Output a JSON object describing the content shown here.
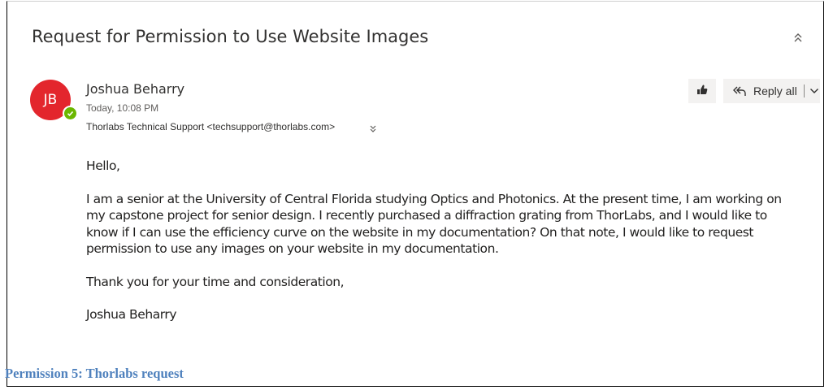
{
  "email": {
    "subject": "Request for Permission to Use Website Images",
    "avatar_initials": "JB",
    "sender_name": "Joshua Beharry",
    "sent_time": "Today, 10:08 PM",
    "recipients": "Thorlabs Technical Support <techsupport@thorlabs.com>",
    "actions": {
      "reply_all_label": "Reply all"
    },
    "body": {
      "greeting": "Hello,",
      "paragraph": "I am a senior at the University of Central Florida studying Optics and Photonics. At the present time, I am working on my capstone project for senior design. I recently purchased a diffraction grating from ThorLabs, and I would like to know if I can use the efficiency curve on the website in my documentation? On that note, I would like to request permission to use any images on your website in my documentation.",
      "closing": "Thank you for your time and consideration,",
      "signature": "Joshua Beharry"
    }
  },
  "caption": "Permission 5: Thorlabs request",
  "colors": {
    "avatar": "#e3262d",
    "presence": "#6bb700",
    "caption": "#4f81bd",
    "button_bg": "#f3f2f1"
  },
  "icons": [
    "collapse-icon",
    "presence-available-icon",
    "expand-recipients-icon",
    "like-icon",
    "reply-all-icon",
    "chevron-down-icon"
  ]
}
